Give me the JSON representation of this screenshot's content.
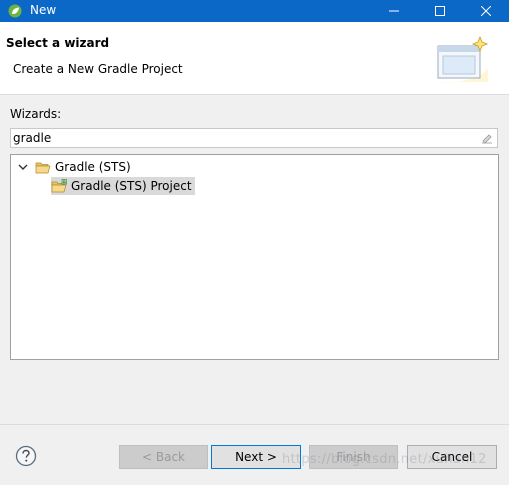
{
  "window": {
    "title": "New",
    "app_icon": "spring-leaf-icon",
    "controls": [
      "minimize-icon",
      "maximize-icon",
      "close-icon"
    ]
  },
  "header": {
    "title": "Select a wizard",
    "subtitle": "Create a New Gradle Project",
    "banner_icon": "wizard-banner-icon"
  },
  "wizards": {
    "label": "Wizards:",
    "filter_value": "gradle"
  },
  "tree": {
    "category": "Gradle (STS)",
    "item": "Gradle (STS) Project"
  },
  "buttons": {
    "back": "< Back",
    "next": "Next >",
    "finish": "Finish",
    "cancel": "Cancel"
  },
  "watermark": "https://blog.csdn.net/xuhan12",
  "colors": {
    "titlebar": "#0c68c6",
    "selection": "#d9d9d9",
    "default_button_border": "#0078d7"
  }
}
